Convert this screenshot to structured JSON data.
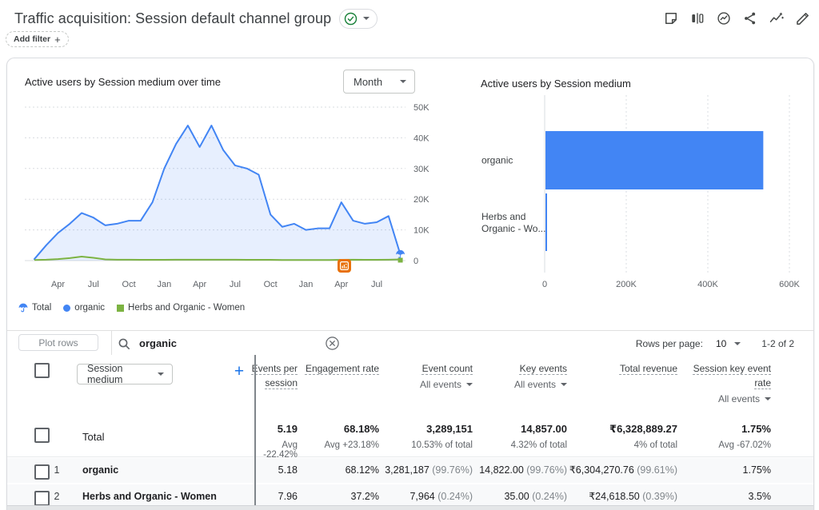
{
  "header": {
    "title": "Traffic acquisition: Session default channel group",
    "add_filter_label": "Add filter",
    "icons": [
      "sticky-note",
      "comparison",
      "insights",
      "share",
      "trend-sparkle",
      "edit"
    ]
  },
  "chart_data": [
    {
      "type": "area",
      "title": "Active users by Session medium over time",
      "granularity": "Month",
      "ylim": [
        0,
        50000
      ],
      "y_tick_labels": [
        "0",
        "10K",
        "20K",
        "30K",
        "40K",
        "50K"
      ],
      "x_tick_labels": [
        "Apr",
        "Jul",
        "Oct",
        "Jan",
        "Apr",
        "Jul",
        "Oct",
        "Jan",
        "Apr",
        "Jul"
      ],
      "x_tick_month_indices": [
        2,
        5,
        8,
        11,
        14,
        17,
        20,
        23,
        26,
        29
      ],
      "grid": true,
      "legend_position": "bottom",
      "series": [
        {
          "name": "organic",
          "color": "#4285f4",
          "fill": "rgba(66,133,244,0.13)",
          "values": [
            500,
            5000,
            9000,
            12000,
            15500,
            14000,
            11500,
            12000,
            13000,
            13000,
            19000,
            30000,
            38000,
            44000,
            37000,
            44000,
            36000,
            31000,
            30000,
            28000,
            15000,
            11000,
            12000,
            10000,
            10500,
            10500,
            19000,
            13000,
            12000,
            12500,
            14500,
            2000
          ]
        },
        {
          "name": "Herbs and Organic - Women",
          "color": "#7cb342",
          "values": [
            200,
            300,
            500,
            800,
            1300,
            900,
            400,
            300,
            300,
            250,
            250,
            250,
            300,
            300,
            300,
            300,
            300,
            300,
            250,
            250,
            250,
            200,
            200,
            200,
            200,
            200,
            250,
            300,
            250,
            250,
            300,
            400
          ]
        }
      ],
      "legend": [
        {
          "label": "Total",
          "marker": "total-umbrella",
          "color": "#4285f4"
        },
        {
          "label": "organic",
          "marker": "dot",
          "color": "#4285f4"
        },
        {
          "label": "Herbs and Organic - Women",
          "marker": "square",
          "color": "#7cb342"
        }
      ],
      "annotations": [
        {
          "type": "anomaly-marker",
          "color": "#e8710a",
          "month_index": 26
        }
      ]
    },
    {
      "type": "bar",
      "orientation": "horizontal",
      "title": "Active users by Session medium",
      "categories": [
        "organic",
        "Herbs and\nOrganic - Wo..."
      ],
      "values": [
        534000,
        2500
      ],
      "xlim": [
        0,
        600000
      ],
      "x_tick_labels": [
        "0",
        "200K",
        "400K",
        "600K"
      ],
      "bar_color": "#4285f4",
      "grid": true
    }
  ],
  "table": {
    "toolbar": {
      "plot_rows_label": "Plot rows",
      "search_value": "organic",
      "rows_per_page_label": "Rows per page:",
      "rows_per_page_value": "10",
      "pagination_range": "1-2 of 2"
    },
    "dimension_selector": "Session medium",
    "columns": [
      {
        "title": "Events per session",
        "sub": ""
      },
      {
        "title": "Engagement rate",
        "sub": ""
      },
      {
        "title": "Event count",
        "sub": "All events"
      },
      {
        "title": "Key events",
        "sub": "All events"
      },
      {
        "title": "Total revenue",
        "sub": ""
      },
      {
        "title": "Session key event rate",
        "sub": "All events"
      }
    ],
    "total_row": {
      "label": "Total",
      "cells": [
        {
          "value": "5.19",
          "secondary": "Avg -22.42%"
        },
        {
          "value": "68.18%",
          "secondary": "Avg +23.18%"
        },
        {
          "value": "3,289,151",
          "secondary": "10.53% of total"
        },
        {
          "value": "14,857.00",
          "secondary": "4.32% of total"
        },
        {
          "value": "₹6,328,889.27",
          "secondary": "4% of total"
        },
        {
          "value": "1.75%",
          "secondary": "Avg -67.02%"
        }
      ]
    },
    "rows": [
      {
        "index": "1",
        "label": "organic",
        "cells": [
          {
            "value": "5.18"
          },
          {
            "value": "68.12%"
          },
          {
            "value": "3,281,187",
            "secondary": "(99.76%)"
          },
          {
            "value": "14,822.00",
            "secondary": "(99.76%)"
          },
          {
            "value": "₹6,304,270.76",
            "secondary": "(99.61%)"
          },
          {
            "value": "1.75%"
          }
        ]
      },
      {
        "index": "2",
        "label": "Herbs and Organic - Women",
        "cells": [
          {
            "value": "7.96"
          },
          {
            "value": "37.2%"
          },
          {
            "value": "7,964",
            "secondary": "(0.24%)"
          },
          {
            "value": "35.00",
            "secondary": "(0.24%)"
          },
          {
            "value": "₹24,618.50",
            "secondary": "(0.39%)"
          },
          {
            "value": "3.5%"
          }
        ]
      }
    ]
  },
  "colors": {
    "blue": "#4285f4",
    "green": "#7cb342",
    "anomaly_orange": "#e8710a",
    "badge_green": "#188038"
  }
}
